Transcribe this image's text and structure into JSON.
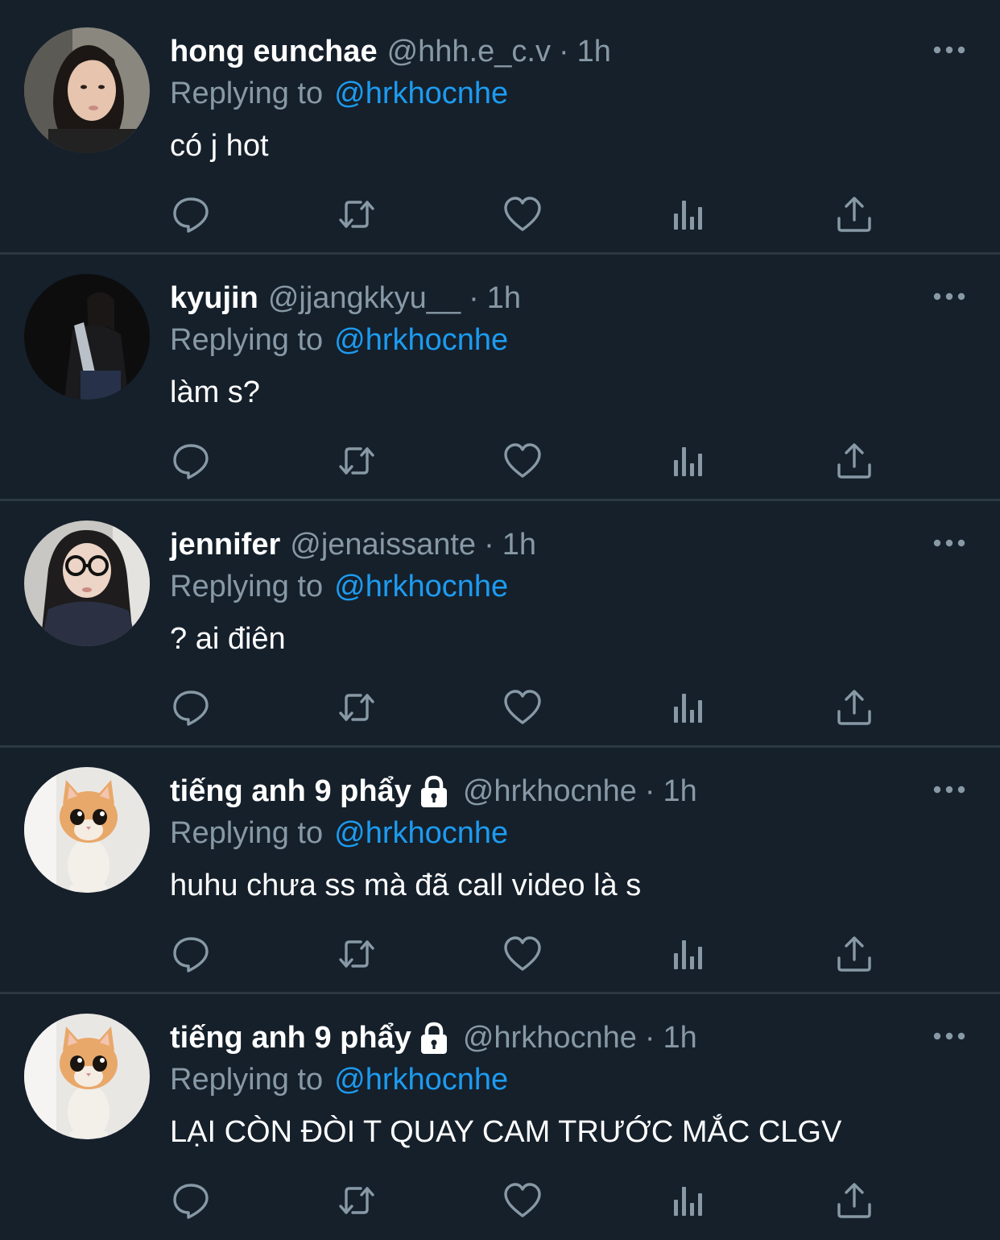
{
  "replies": [
    {
      "name": "hong eunchae",
      "handle": "@hhh.e_c.v",
      "dot": "·",
      "time": "1h",
      "locked": false,
      "replying_label": "Replying to",
      "replying_to": "@hrkhocnhe",
      "text": "có j hot",
      "avatar": "photo-girl-light"
    },
    {
      "name": "kyujin",
      "handle": "@jjangkkyu__",
      "dot": "·",
      "time": "1h",
      "locked": false,
      "replying_label": "Replying to",
      "replying_to": "@hrkhocnhe",
      "text": "làm s?",
      "avatar": "photo-girl-dark"
    },
    {
      "name": "jennifer",
      "handle": "@jenaissante",
      "dot": "·",
      "time": "1h",
      "locked": false,
      "replying_label": "Replying to",
      "replying_to": "@hrkhocnhe",
      "text": "? ai điên",
      "avatar": "photo-girl-glasses"
    },
    {
      "name": "tiếng anh 9 phẩy",
      "handle": "@hrkhocnhe",
      "dot": "·",
      "time": "1h",
      "locked": true,
      "replying_label": "Replying to",
      "replying_to": "@hrkhocnhe",
      "text": "huhu chưa ss mà đã call video là s",
      "avatar": "photo-kitten"
    },
    {
      "name": "tiếng anh 9 phẩy",
      "handle": "@hrkhocnhe",
      "dot": "·",
      "time": "1h",
      "locked": true,
      "replying_label": "Replying to",
      "replying_to": "@hrkhocnhe",
      "text": "LẠI CÒN ĐÒI T QUAY CAM TRƯỚC MẮC CLGV",
      "avatar": "photo-kitten"
    }
  ],
  "actions": [
    "reply-icon",
    "retweet-icon",
    "like-icon",
    "views-icon",
    "share-icon"
  ],
  "colors": {
    "background": "#15202b",
    "divider": "#2b3741",
    "secondary_text": "#8899a6",
    "link": "#1d9bf0",
    "icon": "#8899a6"
  }
}
